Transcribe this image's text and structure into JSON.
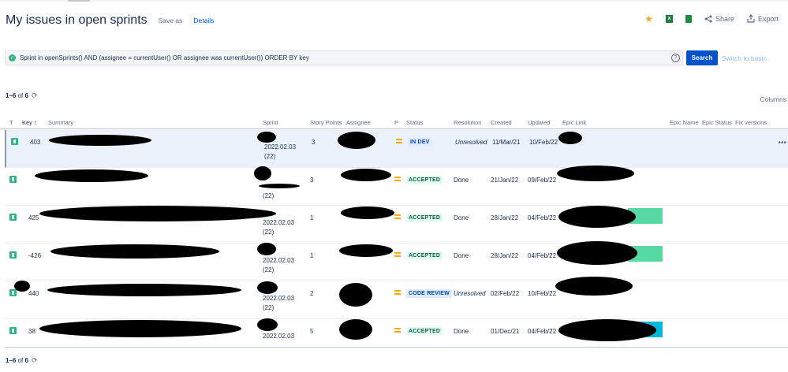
{
  "header": {
    "title": "My issues in open sprints",
    "save_as": "Save as",
    "details": "Details"
  },
  "actions": {
    "share": "Share",
    "export": "Export"
  },
  "query": {
    "jql": "Sprint in openSprints() AND (assignee = currentUser() OR assignee was currentUser()) ORDER BY key",
    "help": "?",
    "search_label": "Search",
    "switch_label": "Switch to basic"
  },
  "pager": {
    "top": "1–6",
    "of": "of",
    "total": "6"
  },
  "columns_label": "Columns",
  "table": {
    "headers": {
      "t": "T",
      "key": "Key",
      "summary": "Summary",
      "sprint": "Sprint",
      "story_points": "Story Points",
      "assignee": "Assignee",
      "p": "P",
      "status": "Status",
      "resolution": "Resolution",
      "created": "Created",
      "updated": "Updated",
      "epic_link": "Epic Link",
      "epic_name": "Epic Name",
      "epic_status": "Epic Status",
      "fix_versions": "Fix versions"
    },
    "rows": [
      {
        "key": "403",
        "sprint_date": "2022.02.03",
        "sprint_count": "(22)",
        "points": "3",
        "status": "IN DEV",
        "resolution": "Unresolved",
        "created": "11/Mar/21",
        "updated": "10/Feb/22"
      },
      {
        "key": "",
        "sprint_date": "",
        "sprint_count": "(22)",
        "points": "3",
        "status": "ACCEPTED",
        "resolution": "Done",
        "created": "21/Jan/22",
        "updated": "09/Feb/22"
      },
      {
        "key": "425",
        "sprint_date": "2022.02.03",
        "sprint_count": "(22)",
        "points": "1",
        "status": "ACCEPTED",
        "resolution": "Done",
        "created": "28/Jan/22",
        "updated": "04/Feb/22"
      },
      {
        "key": "-426",
        "sprint_date": "2022.02.03",
        "sprint_count": "(22)",
        "points": "1",
        "status": "ACCEPTED",
        "resolution": "Done",
        "created": "28/Jan/22",
        "updated": "04/Feb/22"
      },
      {
        "key": "440",
        "sprint_date": "2022.02.03",
        "sprint_count": "(22)",
        "points": "2",
        "status": "CODE REVIEW",
        "resolution": "Unresolved",
        "created": "02/Feb/22",
        "updated": "10/Feb/22"
      },
      {
        "key": "38",
        "sprint_date": "2022.02.03",
        "sprint_count": "",
        "points": "5",
        "status": "ACCEPTED",
        "resolution": "Done",
        "created": "01/Dec/21",
        "updated": "04/Feb/22"
      }
    ]
  },
  "colors": {
    "primary": "#0052cc",
    "accepted_bg": "#e3fcef",
    "accepted_fg": "#006644",
    "inprogress_bg": "#deebff",
    "inprogress_fg": "#0747a6",
    "priority": "#ffab00",
    "epic_green": "#57d9a3",
    "epic_cyan": "#00b8d9"
  }
}
